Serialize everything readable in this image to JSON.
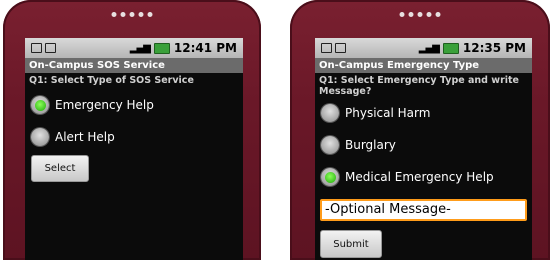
{
  "left": {
    "status_time": "12:41 PM",
    "app_title": "On-Campus SOS Service",
    "question": "Q1: Select Type of SOS Service",
    "options": [
      {
        "label": "Emergency Help",
        "selected": true
      },
      {
        "label": "Alert Help",
        "selected": false
      }
    ],
    "button_label": "Select"
  },
  "right": {
    "status_time": "12:35 PM",
    "app_title": "On-Campus Emergency Type",
    "question": "Q1: Select Emergency Type and write Message?",
    "options": [
      {
        "label": "Physical Harm",
        "selected": false
      },
      {
        "label": "Burglary",
        "selected": false
      },
      {
        "label": "Medical Emergency Help",
        "selected": true
      }
    ],
    "message_value": "-Optional Message-",
    "button_label": "Submit"
  },
  "colors": {
    "phone_body": "#6a1828",
    "title_bar": "#6b6b6b",
    "focus_orange": "#ff9c1a",
    "radio_green": "#1ea80a"
  }
}
